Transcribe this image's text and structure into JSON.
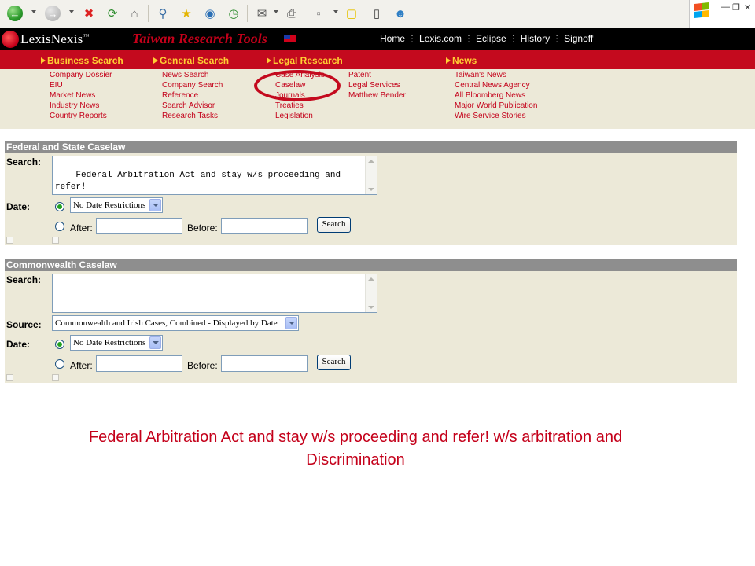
{
  "browser": {
    "toolbar_icons": [
      "back-icon",
      "forward-icon",
      "stop-icon",
      "refresh-icon",
      "home-icon",
      "search-icon",
      "favorites-icon",
      "media-icon",
      "history-icon",
      "mail-icon",
      "print-icon",
      "edit-icon",
      "discuss-icon",
      "research-icon",
      "messenger-icon"
    ],
    "window_controls": [
      "minimize",
      "restore",
      "close"
    ]
  },
  "brand": {
    "logo_text": "LexisNexis",
    "tm": "™",
    "title": "Taiwan Research Tools"
  },
  "top_nav": [
    "Home",
    "Lexis.com",
    "Eclipse",
    "History",
    "Signoff"
  ],
  "categories": [
    {
      "label": "Business Search",
      "links": [
        "Company Dossier",
        "EIU",
        "Market News",
        "Industry News",
        "Country Reports"
      ]
    },
    {
      "label": "General Search",
      "links": [
        "News Search",
        "Company Search",
        "Reference",
        "Search Advisor",
        "Research Tasks"
      ]
    },
    {
      "label": "Legal Research",
      "links": [
        "Case Analysis",
        "Caselaw",
        "Journals",
        "Treaties",
        "Legislation"
      ],
      "links2": [
        "Patent",
        "Legal Services",
        "Matthew Bender"
      ]
    },
    {
      "label": "News",
      "links": [
        "Taiwan's News",
        "Central News Agency",
        "All Bloomberg News",
        "Major World Publication",
        "Wire Service Stories"
      ]
    }
  ],
  "panels": [
    {
      "title": "Federal and State Caselaw",
      "search_label": "Search:",
      "search_value": "Federal Arbitration Act and stay w/s proceeding and refer!\nw/s arbitration and Discrimination |",
      "date_label": "Date:",
      "date_select": "No Date Restrictions",
      "after_label": "After:",
      "before_label": "Before:",
      "search_button": "Search"
    },
    {
      "title": "Commonwealth Caselaw",
      "search_label": "Search:",
      "search_value": "",
      "source_label": "Source:",
      "source_select": "Commonwealth and Irish Cases, Combined - Displayed by Date",
      "date_label": "Date:",
      "date_select": "No Date Restrictions",
      "after_label": "After:",
      "before_label": "Before:",
      "search_button": "Search"
    }
  ],
  "caption": "Federal Arbitration Act and stay w/s proceeding and refer! w/s arbitration and Discrimination",
  "colors": {
    "brand_red": "#c40a1e",
    "category_yellow": "#ffcf33",
    "panel_bg": "#ece9d8",
    "panel_header": "#8e8e8e",
    "caption_red": "#c4001a"
  }
}
